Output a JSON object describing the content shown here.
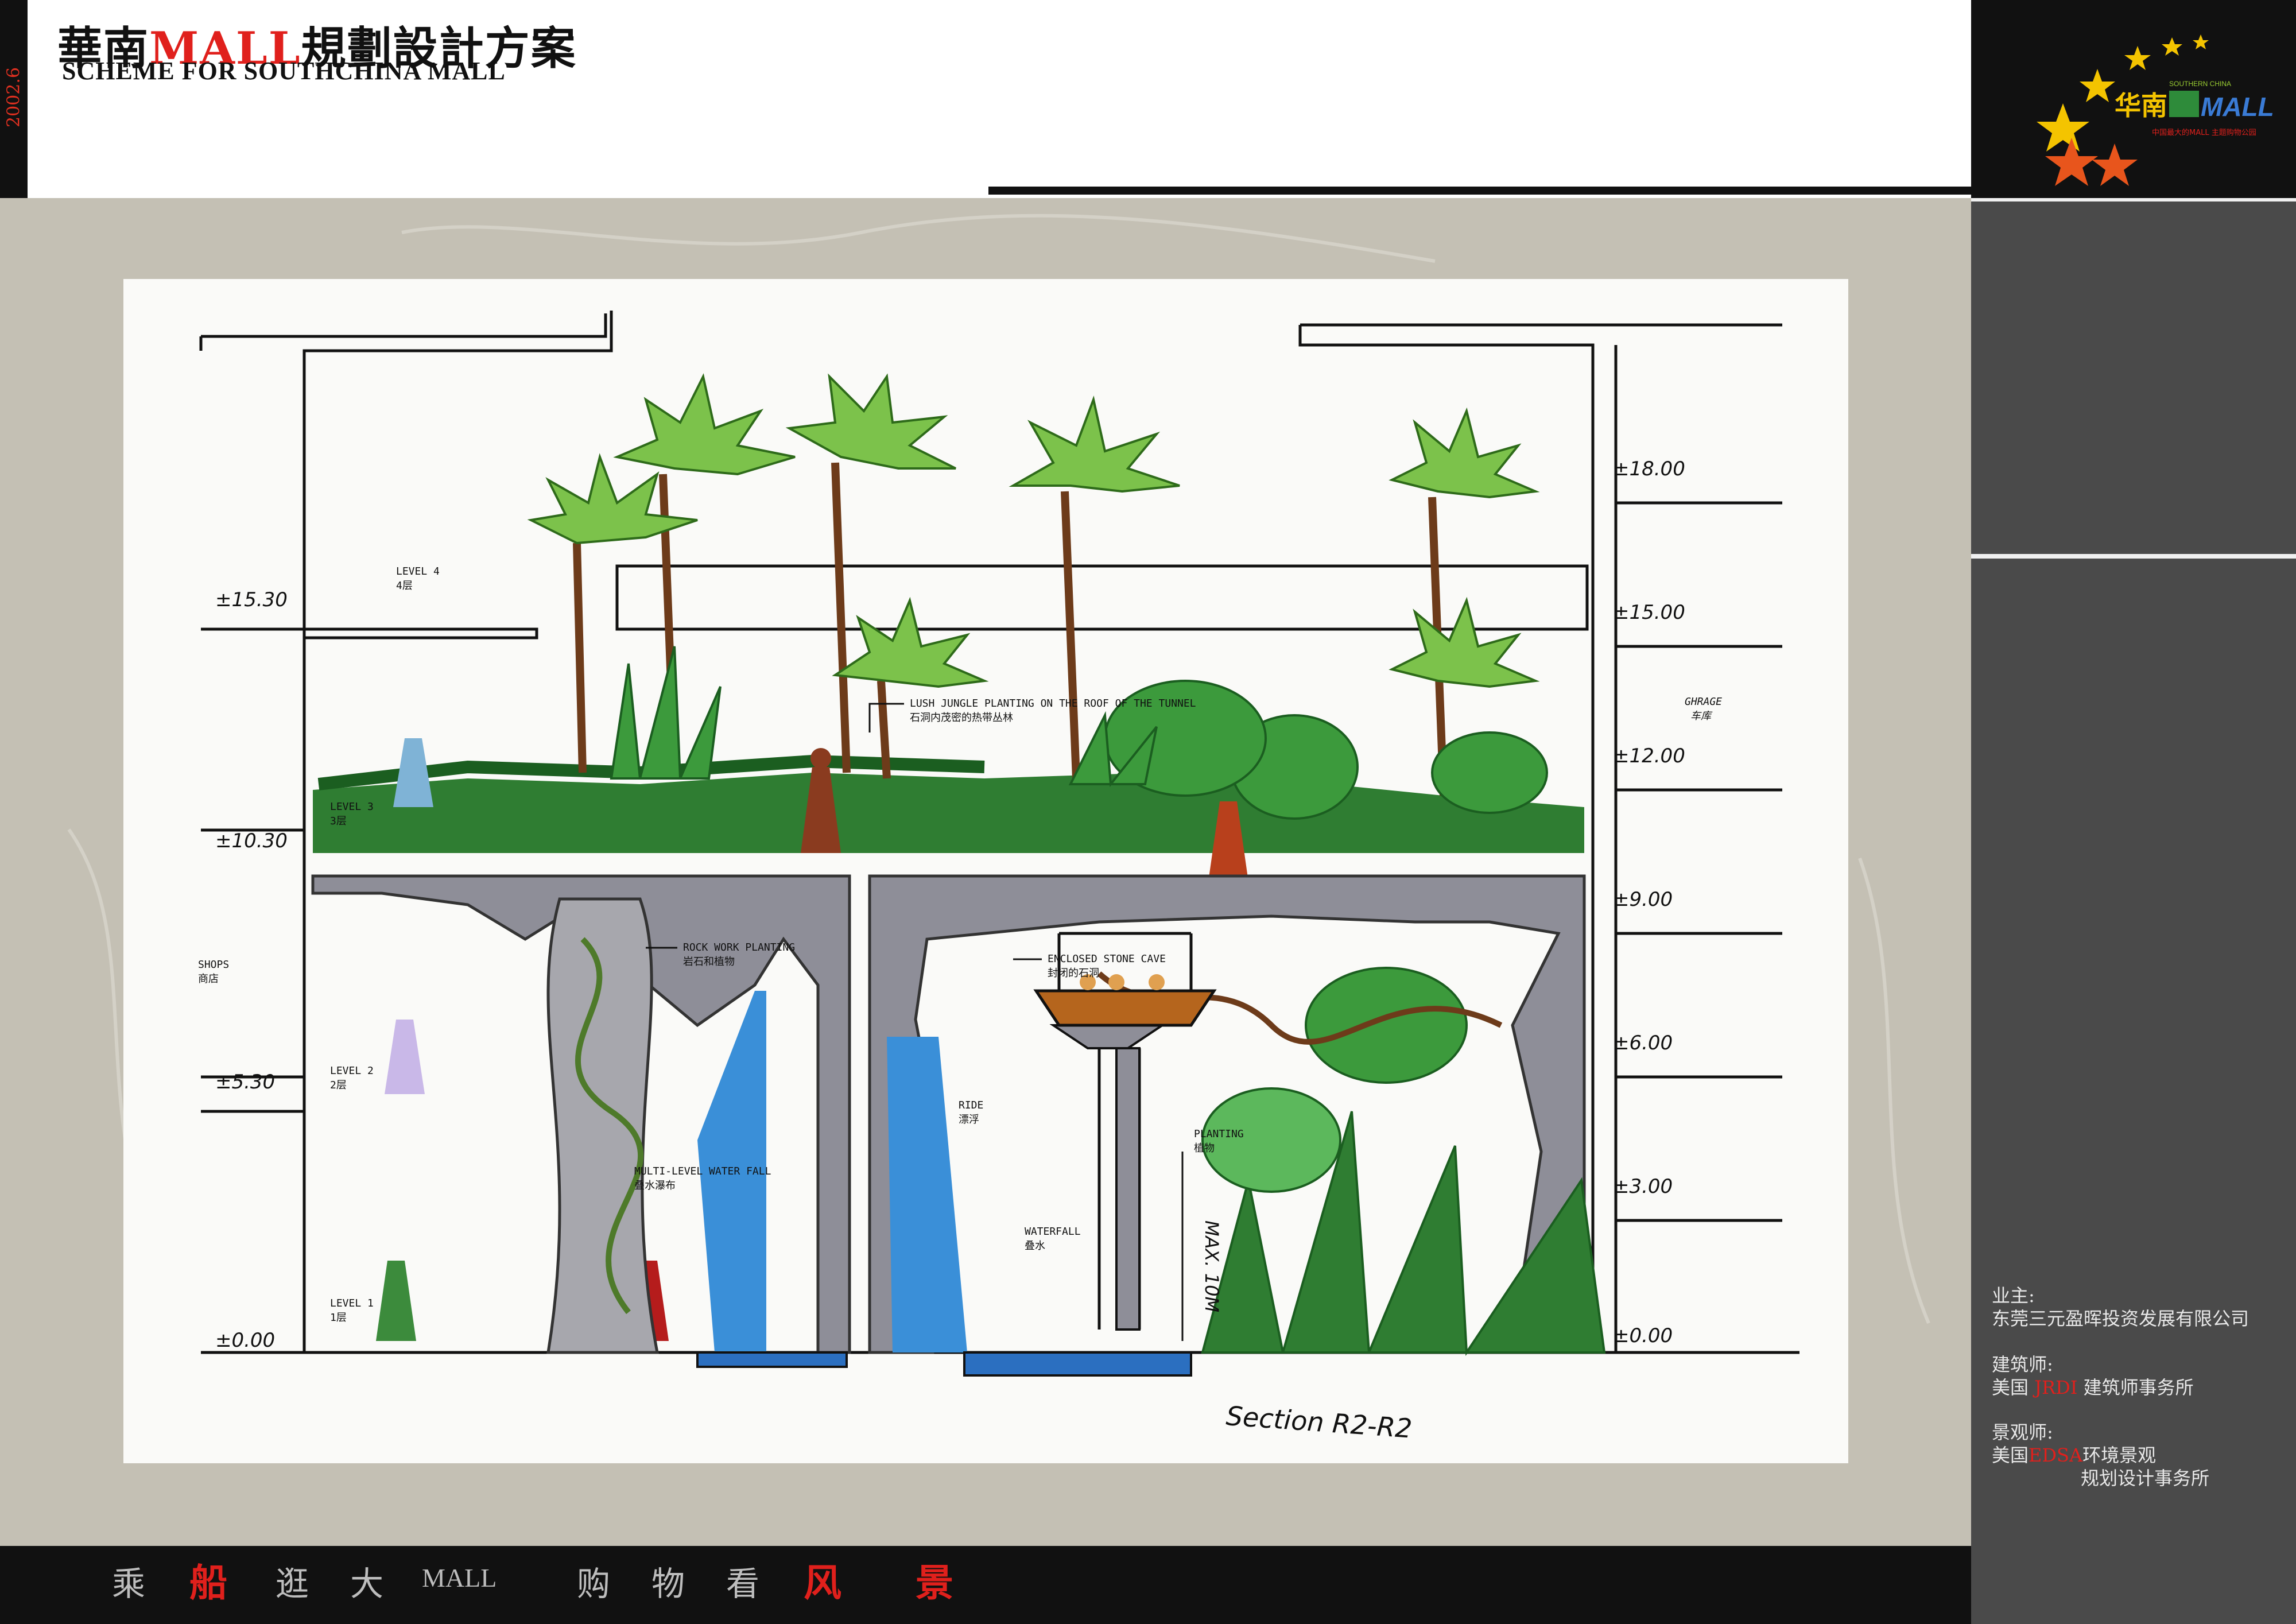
{
  "header": {
    "date": "2002.6",
    "title_cn_prefix": "華南",
    "title_cn_brand": "MALL",
    "title_cn_suffix": "規劃設計方案",
    "title_en": "SCHEME FOR SOUTHCHINA MALL"
  },
  "logo": {
    "brand_cn": "华南",
    "brand_en": "MALL",
    "tagline_small": "SOUTHERN CHINA",
    "subtitle": "中国最大的MALL  主题购物公园"
  },
  "colors": {
    "accent_red": "#e0201c",
    "dark": "#111111",
    "panel_gray": "#4a4a4a",
    "backdrop_gray": "#c4c0b4",
    "foliage_green": "#2f7d32",
    "rock_gray": "#8e8e98",
    "water_blue": "#3a8fd8"
  },
  "section": {
    "left_levels": [
      {
        "elev": "±15.30",
        "name": "LEVEL 4",
        "cn": "4层"
      },
      {
        "elev": "±10.30",
        "name": "LEVEL 3",
        "cn": "3层"
      },
      {
        "elev": "±5.30",
        "name": "LEVEL 2",
        "cn": "2层"
      },
      {
        "elev": "±0.00",
        "name": "LEVEL 1",
        "cn": "1层"
      }
    ],
    "shops": {
      "en": "SHOPS",
      "cn": "商店"
    },
    "right_elevs": [
      "±18.00",
      "±15.00",
      "±12.00",
      "±9.00",
      "±6.00",
      "±3.00",
      "±0.00"
    ],
    "garage": {
      "en": "GHRAGE",
      "cn": "车库"
    },
    "annotations": {
      "jungle_en": "LUSH JUNGLE PLANTING ON THE ROOF OF THE TUNNEL",
      "jungle_cn": "石洞内茂密的热带丛林",
      "rock_en": "ROCK WORK PLANTING",
      "rock_cn": "岩石和植物",
      "cave_en": "ENCLOSED STONE CAVE",
      "cave_cn": "封闭的石洞",
      "ride_en": "RIDE",
      "ride_cn": "漂浮",
      "planting_en": "PLANTING",
      "planting_cn": "植物",
      "multifall_en": "MULTI-LEVEL WATER FALL",
      "multifall_cn": "叠水瀑布",
      "waterfall_en": "WATERFALL",
      "waterfall_cn": "叠水"
    },
    "section_label": "Section R2-R2",
    "max_note": "MAX. 10M"
  },
  "credits": {
    "owner_label": "业主:",
    "owner": "东莞三元盈晖投资发展有限公司",
    "architect_label": "建筑师:",
    "architect_prefix": "美国",
    "architect_red": "JRDI",
    "architect_suffix": "建筑师事务所",
    "landscape_label": "景观师:",
    "landscape_prefix": "美国",
    "landscape_red": "EDSA",
    "landscape_suffix": "环境景观",
    "landscape_line2": "规划设计事务所"
  },
  "footer": {
    "c1": "乘",
    "c2": "船",
    "c3": "逛",
    "c4": "大",
    "c5": "MALL",
    "c6": "购",
    "c7": "物",
    "c8": "看",
    "c9": "风",
    "c10": "景"
  }
}
